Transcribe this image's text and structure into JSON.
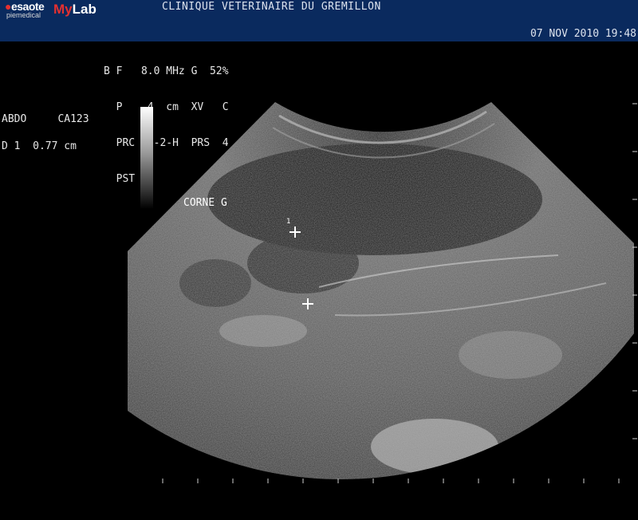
{
  "header": {
    "brand_primary": "esaote",
    "brand_secondary": "piemedical",
    "product_my": "My",
    "product_lab": "Lab",
    "clinic_name": "CLINIQUE VETERINAIRE DU GREMILLON",
    "datetime": "07 NOV 2010 19:48"
  },
  "params": {
    "line1": "B F   8.0 MHz G  52%",
    "line2": "  P    4  cm  XV   C",
    "line3": "  PRC 10-2-H  PRS  4",
    "line4": "  PST 4"
  },
  "exam": {
    "preset": "ABDO",
    "probe": "CA123"
  },
  "measurement": {
    "label": "D 1",
    "value": "0.77 cm"
  },
  "image": {
    "annotation": "CORNE G",
    "cursor_index": "1"
  },
  "colors": {
    "header_bg": "#0a2a5e",
    "brand_red": "#e53030"
  }
}
